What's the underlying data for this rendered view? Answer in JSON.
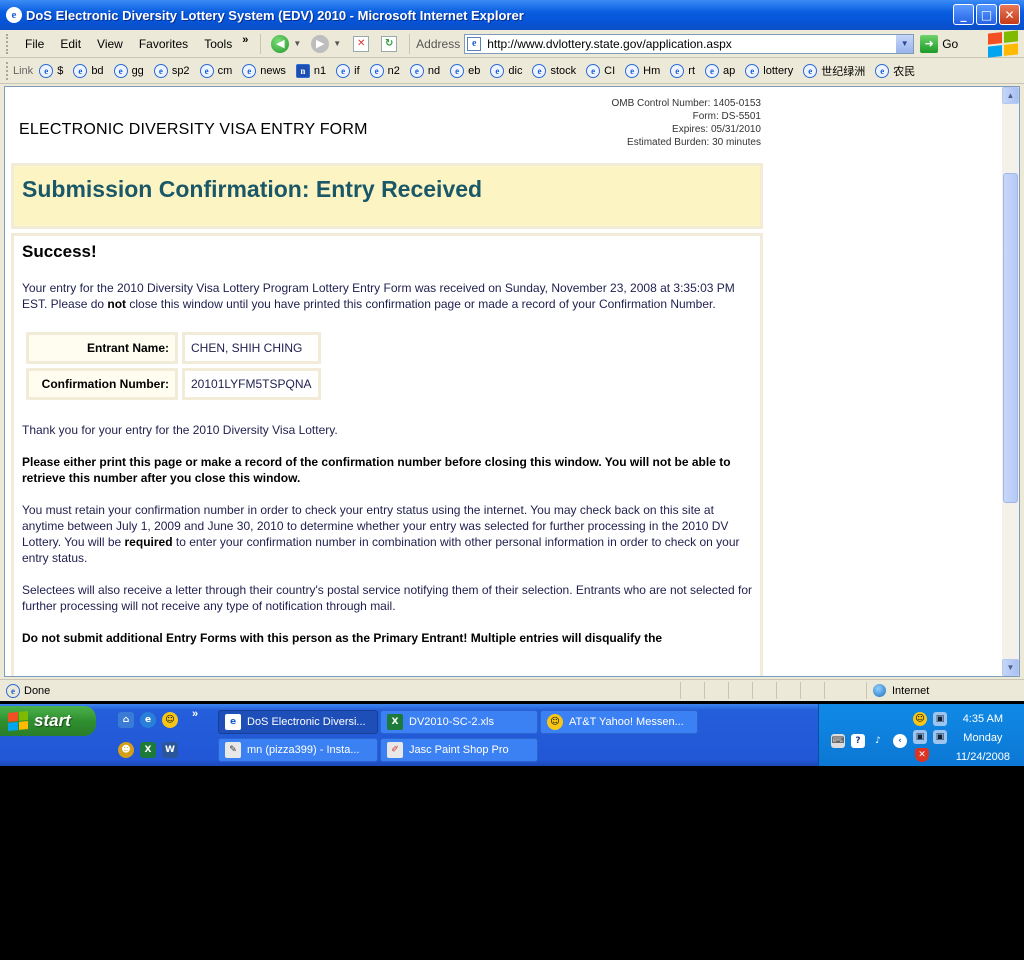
{
  "window": {
    "title": "DoS Electronic Diversity Lottery System (EDV) 2010 - Microsoft Internet Explorer"
  },
  "menu": [
    "File",
    "Edit",
    "View",
    "Favorites",
    "Tools"
  ],
  "address": {
    "label": "Address",
    "url": "http://www.dvlottery.state.gov/application.aspx",
    "go_label": "Go"
  },
  "links_bar": {
    "label": "Link",
    "items": [
      "$",
      "bd",
      "gg",
      "sp2",
      "cm",
      "news",
      "n1",
      "if",
      "n2",
      "nd",
      "eb",
      "dic",
      "stock",
      "CI",
      "Hm",
      "rt",
      "ap",
      "lottery",
      "世纪绿洲",
      "农民"
    ]
  },
  "page": {
    "form_title": "ELECTRONIC DIVERSITY VISA ENTRY FORM",
    "omb": [
      "OMB Control Number: 1405-0153",
      "Form: DS-5501",
      "Expires: 05/31/2010",
      "Estimated Burden: 30 minutes"
    ],
    "banner_title": "Submission Confirmation: Entry Received",
    "success_heading": "Success!",
    "para1_start": "Your entry for the 2010 Diversity Visa Lottery Program Lottery Entry Form was received on Sunday, November 23, 2008 at 3:35:03 PM EST. Please do ",
    "para1_bold": "not",
    "para1_end": " close this window until you have printed this confirmation page or made a record of your Confirmation Number.",
    "entrant_label": "Entrant Name:",
    "entrant_value": "CHEN, SHIH CHING",
    "confirmation_label": "Confirmation Number:",
    "confirmation_value": "20101LYFM5TSPQNA",
    "thanks": "Thank you for your entry for the 2010 Diversity Visa Lottery.",
    "warning": "Please either print this page or make a record of the confirmation number before closing this window. You will not be able to retrieve this number after you close this window.",
    "para3_start": "You must retain your confirmation number in order to check your entry status using the internet. You may check back on this site at anytime between July 1, 2009 and June 30, 2010 to determine whether your entry was selected for further processing in the 2010 DV Lottery. You will be ",
    "para3_bold": "required",
    "para3_end": " to enter your confirmation number in combination with other personal information in order to check on your entry status.",
    "para4": "Selectees will also receive a letter through their country's postal service notifying them of their selection. Entrants who are not selected for further processing will not receive any type of notification through mail.",
    "para5": "Do not submit additional Entry Forms with this person as the Primary Entrant! Multiple entries will disqualify the"
  },
  "status": {
    "text": "Done",
    "zone": "Internet"
  },
  "taskbar": {
    "start_label": "start",
    "tasks": [
      "DoS Electronic Diversi...",
      "DV2010-SC-2.xls",
      "AT&T Yahoo! Messen...",
      "mn (pizza399) - Insta...",
      "Jasc Paint Shop Pro"
    ],
    "clock_time": "4:35 AM",
    "clock_day": "Monday",
    "clock_date": "11/24/2008"
  },
  "colors": {
    "banner_bg": "#fdf4c4",
    "banner_text": "#1a5868",
    "xp_blue": "#0654d8",
    "start_green": "#2f8f2f"
  }
}
